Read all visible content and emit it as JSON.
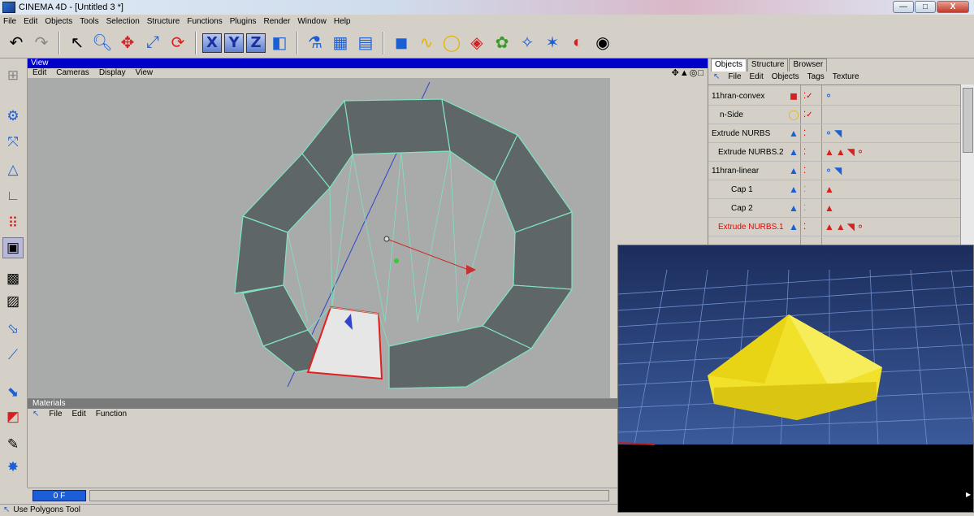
{
  "window": {
    "title": "CINEMA 4D - [Untitled 3 *]",
    "minimize": "—",
    "maximize": "□",
    "close": "X"
  },
  "menubar": [
    "File",
    "Edit",
    "Objects",
    "Tools",
    "Selection",
    "Structure",
    "Functions",
    "Plugins",
    "Render",
    "Window",
    "Help"
  ],
  "viewport": {
    "title": "View",
    "menu": [
      "Edit",
      "Cameras",
      "Display",
      "View"
    ],
    "nav_icons": "✥▲◎□"
  },
  "object_manager": {
    "tabs": [
      "Objects",
      "Structure",
      "Browser"
    ],
    "menu": [
      "File",
      "Edit",
      "Objects",
      "Tags",
      "Texture"
    ],
    "rows": [
      {
        "name": "11hran-convex",
        "red": false
      },
      {
        "name": "n-Side",
        "red": false
      },
      {
        "name": "Extrude NURBS",
        "red": false
      },
      {
        "name": "Extrude NURBS.2",
        "red": false
      },
      {
        "name": "11hran-linear",
        "red": false
      },
      {
        "name": "Cap 1",
        "red": false
      },
      {
        "name": "Cap 2",
        "red": false
      },
      {
        "name": "Extrude NURBS.1",
        "red": true
      }
    ]
  },
  "materials": {
    "title": "Materials",
    "menu": [
      "File",
      "Edit",
      "Function"
    ]
  },
  "timeline": {
    "frame": "0 F"
  },
  "status": {
    "text": "Use Polygons Tool"
  },
  "colors": {
    "viewport_title_bar": "#0000c8",
    "viewport_bg": "#a9aaaa",
    "render_object": "#f2e12a",
    "render_floor": "#2f4b86",
    "selected_object_text": "#ee0000"
  },
  "icons": {
    "toolbar": [
      "undo-icon",
      "redo-icon",
      "select-arrow-icon",
      "magnify-icon",
      "move-icon",
      "scale-icon",
      "rotate-icon",
      "x-axis-icon",
      "y-axis-icon",
      "z-axis-icon",
      "coordinate-system-icon",
      "render-view-icon",
      "render-picture-viewer-icon",
      "render-settings-icon",
      "cube-primitive-icon",
      "spline-icon",
      "nurbs-icon",
      "deformer-icon",
      "scene-icon",
      "light-icon",
      "camera-icon"
    ],
    "left_tools": [
      "model-mode-icon",
      "object-mode-icon",
      "axis-mode-icon",
      "points-mode-icon",
      "edges-mode-icon",
      "polygons-mode-icon",
      "texture-mode-icon",
      "checker-icon",
      "uvw-icon",
      "animation-icon",
      "keyframe-icon",
      "paint-icon",
      "magnet-icon",
      "snap-icon"
    ]
  }
}
